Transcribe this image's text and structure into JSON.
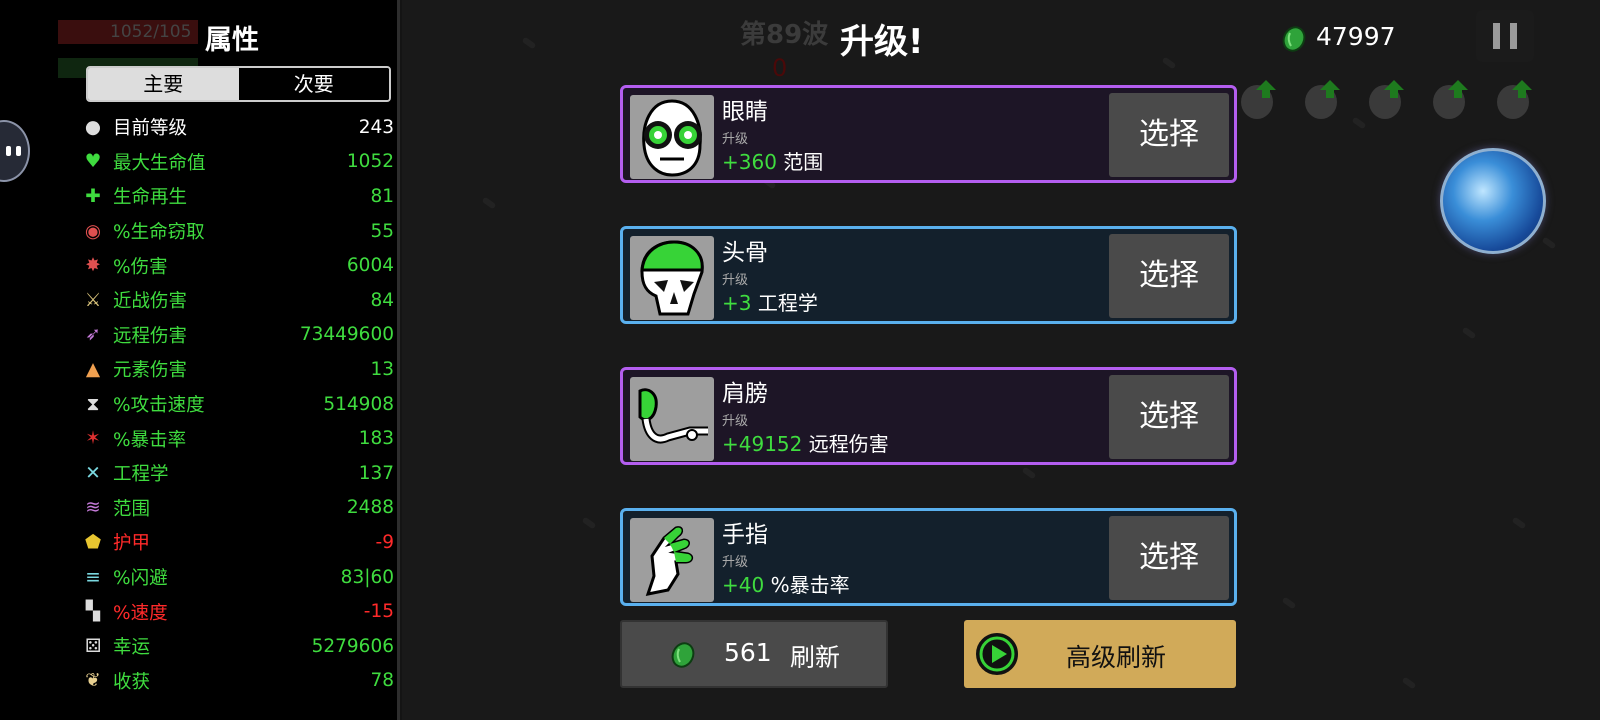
{
  "stats_panel": {
    "ghost_hp": "1052/105",
    "title": "属性",
    "tabs": {
      "main": "主要",
      "secondary": "次要"
    },
    "rows": [
      {
        "icon": "level-icon",
        "label": "目前等级",
        "value": "243",
        "label_color": "#ffffff",
        "value_color": "#ffffff"
      },
      {
        "icon": "heart-icon",
        "label": "最大生命值",
        "value": "1052",
        "label_color": "#3fdc3f",
        "value_color": "#3fdc3f"
      },
      {
        "icon": "regen-icon",
        "label": "生命再生",
        "value": "81",
        "label_color": "#3fdc3f",
        "value_color": "#3fdc3f"
      },
      {
        "icon": "lifesteal-icon",
        "label": "%生命窃取",
        "value": "55",
        "label_color": "#3fdc3f",
        "value_color": "#3fdc3f"
      },
      {
        "icon": "damage-icon",
        "label": "%伤害",
        "value": "6004",
        "label_color": "#3fdc3f",
        "value_color": "#3fdc3f"
      },
      {
        "icon": "melee-icon",
        "label": "近战伤害",
        "value": "84",
        "label_color": "#3fdc3f",
        "value_color": "#3fdc3f"
      },
      {
        "icon": "ranged-icon",
        "label": "远程伤害",
        "value": "73449600",
        "label_color": "#3fdc3f",
        "value_color": "#3fdc3f"
      },
      {
        "icon": "elemental-icon",
        "label": "元素伤害",
        "value": "13",
        "label_color": "#3fdc3f",
        "value_color": "#3fdc3f"
      },
      {
        "icon": "hourglass-icon",
        "label": "%攻击速度",
        "value": "514908",
        "label_color": "#3fdc3f",
        "value_color": "#3fdc3f"
      },
      {
        "icon": "crit-icon",
        "label": "%暴击率",
        "value": "183",
        "label_color": "#3fdc3f",
        "value_color": "#3fdc3f"
      },
      {
        "icon": "engineering-icon",
        "label": "工程学",
        "value": "137",
        "label_color": "#3fdc3f",
        "value_color": "#3fdc3f"
      },
      {
        "icon": "range-icon",
        "label": "范围",
        "value": "2488",
        "label_color": "#3fdc3f",
        "value_color": "#3fdc3f"
      },
      {
        "icon": "armor-icon",
        "label": "护甲",
        "value": "-9",
        "label_color": "#ff2a2a",
        "value_color": "#ff2a2a"
      },
      {
        "icon": "dodge-icon",
        "label": "%闪避",
        "value": "83|60",
        "label_color": "#3fdc3f",
        "value_color": "#3fdc3f"
      },
      {
        "icon": "speed-icon",
        "label": "%速度",
        "value": "-15",
        "label_color": "#ff2a2a",
        "value_color": "#ff2a2a"
      },
      {
        "icon": "dice-icon",
        "label": "幸运",
        "value": "5279606",
        "label_color": "#3fdc3f",
        "value_color": "#3fdc3f"
      },
      {
        "icon": "harvest-icon",
        "label": "收获",
        "value": "78",
        "label_color": "#3fdc3f",
        "value_color": "#3fdc3f"
      }
    ]
  },
  "header": {
    "wave": "第89波",
    "wave_timer": "0",
    "title": "升级!",
    "gold": "47997"
  },
  "upgrades": [
    {
      "name": "眼睛",
      "kind": "升级",
      "amount": "+360",
      "stat": "范围",
      "select": "选择",
      "icon": "eyes-icon",
      "tier": "purple"
    },
    {
      "name": "头骨",
      "kind": "升级",
      "amount": "+3",
      "stat": "工程学",
      "select": "选择",
      "icon": "skull-icon",
      "tier": "blue"
    },
    {
      "name": "肩膀",
      "kind": "升级",
      "amount": "+49152",
      "stat": "远程伤害",
      "select": "选择",
      "icon": "shoulder-icon",
      "tier": "purple"
    },
    {
      "name": "手指",
      "kind": "升级",
      "amount": "+40",
      "stat": "%暴击率",
      "select": "选择",
      "icon": "fingers-icon",
      "tier": "blue"
    }
  ],
  "reroll": {
    "cost": "561",
    "label": "刷新"
  },
  "advanced_reroll": {
    "label": "高级刷新"
  },
  "colors": {
    "accent_green": "#3fdc3f",
    "negative_red": "#ff2a2a",
    "gold_button": "#d1aa59",
    "purple_tier": "#b45ef0",
    "blue_tier": "#5ab0ee"
  }
}
